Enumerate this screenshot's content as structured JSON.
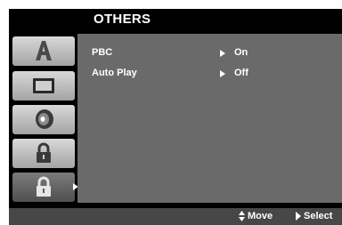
{
  "menu": {
    "title": "OTHERS",
    "tabs": [
      {
        "icon": "text-a-icon"
      },
      {
        "icon": "monitor-icon"
      },
      {
        "icon": "speaker-icon"
      },
      {
        "icon": "padlock-icon"
      },
      {
        "icon": "padlock-icon",
        "active": true
      }
    ],
    "items": [
      {
        "label": "PBC",
        "value": "On"
      },
      {
        "label": "Auto Play",
        "value": "Off"
      }
    ],
    "hints": {
      "move_label": "Move",
      "select_label": "Select"
    }
  },
  "colors": {
    "background": "#000000",
    "panel": "#6a6a6a",
    "bar": "#474747",
    "text": "#ffffff"
  }
}
